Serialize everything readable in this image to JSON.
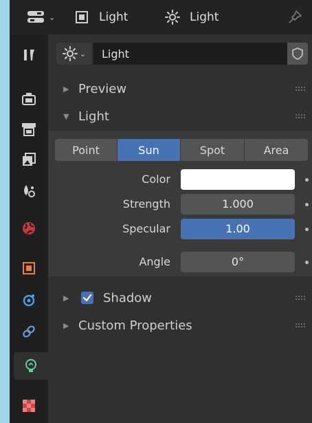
{
  "header": {
    "context_label": "Light",
    "data_label": "Light"
  },
  "datablock": {
    "name": "Light"
  },
  "sections": {
    "preview": "Preview",
    "light": "Light",
    "shadow": "Shadow",
    "custom_properties": "Custom Properties"
  },
  "light_types": [
    "Point",
    "Sun",
    "Spot",
    "Area"
  ],
  "selected_light_type": "Sun",
  "properties": {
    "color_label": "Color",
    "color_value": "#ffffff",
    "strength_label": "Strength",
    "strength_value": "1.000",
    "specular_label": "Specular",
    "specular_value": "1.00",
    "angle_label": "Angle",
    "angle_value": "0°"
  },
  "shadow_enabled": true,
  "colors": {
    "accent": "#4772b3",
    "panel": "#303030",
    "header": "#232323",
    "sidebar": "#1f1f1f"
  },
  "icons": {
    "editor_type": "properties-editor-icon",
    "context": "object-data-icon",
    "light": "sun-light-icon",
    "pin": "pin-icon",
    "fake_user": "shield-icon",
    "tabs": [
      "tool-icon",
      "render-icon",
      "output-icon",
      "view-layer-icon",
      "scene-icon",
      "world-icon",
      "object-icon",
      "physics-icon",
      "constraints-icon",
      "light-data-icon",
      "texture-icon"
    ]
  }
}
